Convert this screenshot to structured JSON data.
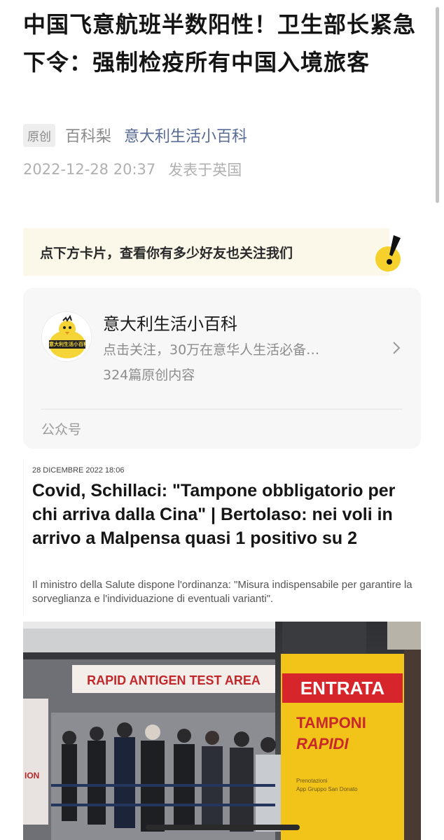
{
  "article": {
    "title": "中国飞意航班半数阳性！卫生部长紧急下令：强制检疫所有中国入境旅客",
    "original_tag": "原创",
    "author": "百科梨",
    "account_name": "意大利生活小百科",
    "date": "2022-12-28 20:37",
    "location": "发表于英国"
  },
  "banner": {
    "text": "点下方卡片，查看你有多少好友也关注我们"
  },
  "account_card": {
    "name": "意大利生活小百科",
    "description": "点击关注，30万在意华人生活必备…",
    "count": "324篇原创内容",
    "footer": "公众号",
    "avatar_text": "意大利生活小百科"
  },
  "news": {
    "date": "28 DICEMBRE 2022 18:06",
    "headline": "Covid, Schillaci: \"Tampone obbligatorio per chi arriva dalla Cina\" | Bertolaso: nei voli in arrivo a Malpensa quasi 1 positivo su 2",
    "subheadline": "Il ministro della Salute dispone l'ordinanza: \"Misura indispensabile per garantire la sorveglianza e l'individuazione di eventuali varianti\"."
  },
  "photo": {
    "sign_top": "RAPID ANTIGEN TEST AREA",
    "sign_entrata": "ENTRATA",
    "sign_tamponi": "TAMPONI",
    "sign_rapidi": "RAPIDI",
    "sign_small_1": "Prenotazioni",
    "sign_small_2": "App Gruppo San Donato",
    "sign_left": "ION"
  },
  "colors": {
    "link": "#576b95",
    "banner_bg": "#fbf8ea",
    "accent_yellow": "#f6d02b"
  }
}
